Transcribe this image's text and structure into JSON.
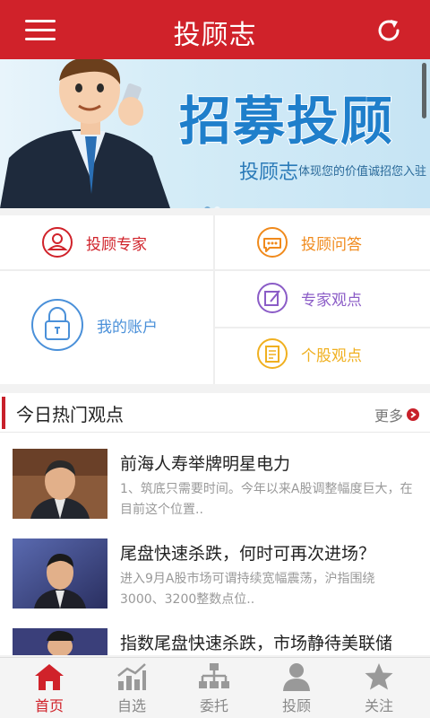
{
  "header": {
    "title": "投顾志"
  },
  "banner": {
    "headline": "招募投顾",
    "brand": "投顾志",
    "slogan": "体现您的价值诚招您入驻"
  },
  "grid": {
    "expert": "投顾专家",
    "qa": "投顾问答",
    "account": "我的账户",
    "expert_views": "专家观点",
    "stock_views": "个股观点"
  },
  "hot": {
    "title": "今日热门观点",
    "more": "更多",
    "articles": [
      {
        "title": "前海人寿举牌明星电力",
        "summary": "1、筑底只需要时间。今年以来A股调整幅度巨大，在目前这个位置.."
      },
      {
        "title": "尾盘快速杀跌，何时可再次进场？",
        "summary": "进入9月A股市场可谓持续宽幅震荡，沪指围绕3000、3200整数点位.."
      },
      {
        "title": "指数尾盘快速杀跌，市场静待美联储",
        "summary": ""
      }
    ]
  },
  "tabs": [
    {
      "label": "首页",
      "active": true
    },
    {
      "label": "自选",
      "active": false
    },
    {
      "label": "委托",
      "active": false
    },
    {
      "label": "投顾",
      "active": false
    },
    {
      "label": "关注",
      "active": false
    }
  ],
  "colors": {
    "brand": "#d0222a",
    "expert": "#d0222a",
    "qa": "#f08a1c",
    "account": "#4a90d9",
    "views": "#8b5cc7",
    "stock": "#f0b020"
  }
}
